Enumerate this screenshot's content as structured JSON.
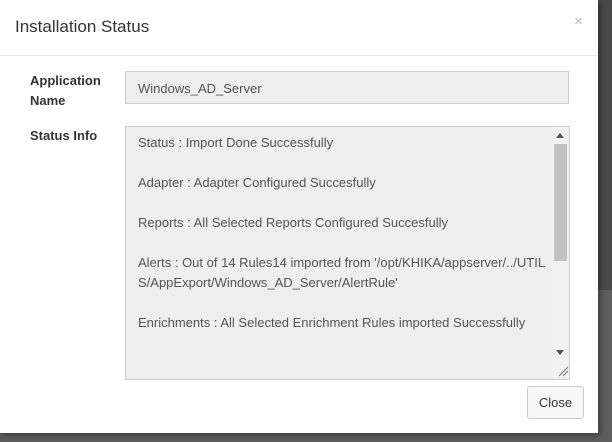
{
  "modal": {
    "title": "Installation Status",
    "close_icon": "×"
  },
  "form": {
    "app_label": "Application Name",
    "app_value": "Windows_AD_Server",
    "status_label": "Status Info",
    "status_lines": [
      "Status : Import Done Successfully",
      "Adapter : Adapter Configured Succesfully",
      "Reports : All Selected Reports Configured Succesfully",
      "Alerts : Out of 14 Rules14 imported from '/opt/KHIKA/appserver/../UTILS/AppExport/Windows_AD_Server/AlertRule'",
      "Enrichments : All Selected Enrichment Rules imported Successfully"
    ]
  },
  "footer": {
    "close_label": "Close"
  }
}
